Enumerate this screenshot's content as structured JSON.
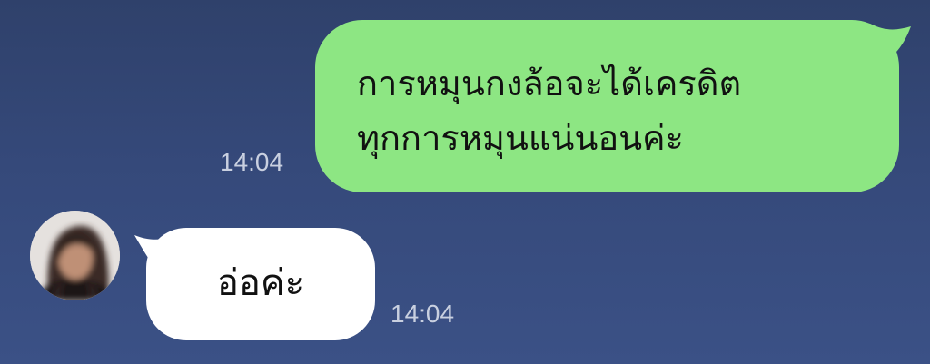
{
  "messages": [
    {
      "direction": "outgoing",
      "text": "การหมุนกงล้อจะได้เครดิต\nทุกการหมุนแน่นอนค่ะ",
      "time": "14:04",
      "bubble_color": "#8de683"
    },
    {
      "direction": "incoming",
      "text": "อ่อค่ะ",
      "time": "14:04",
      "bubble_color": "#ffffff",
      "avatar_icon": "user-avatar-blurred"
    }
  ],
  "theme": {
    "background": "#35497a",
    "timestamp_color": "#c9d0e0"
  }
}
